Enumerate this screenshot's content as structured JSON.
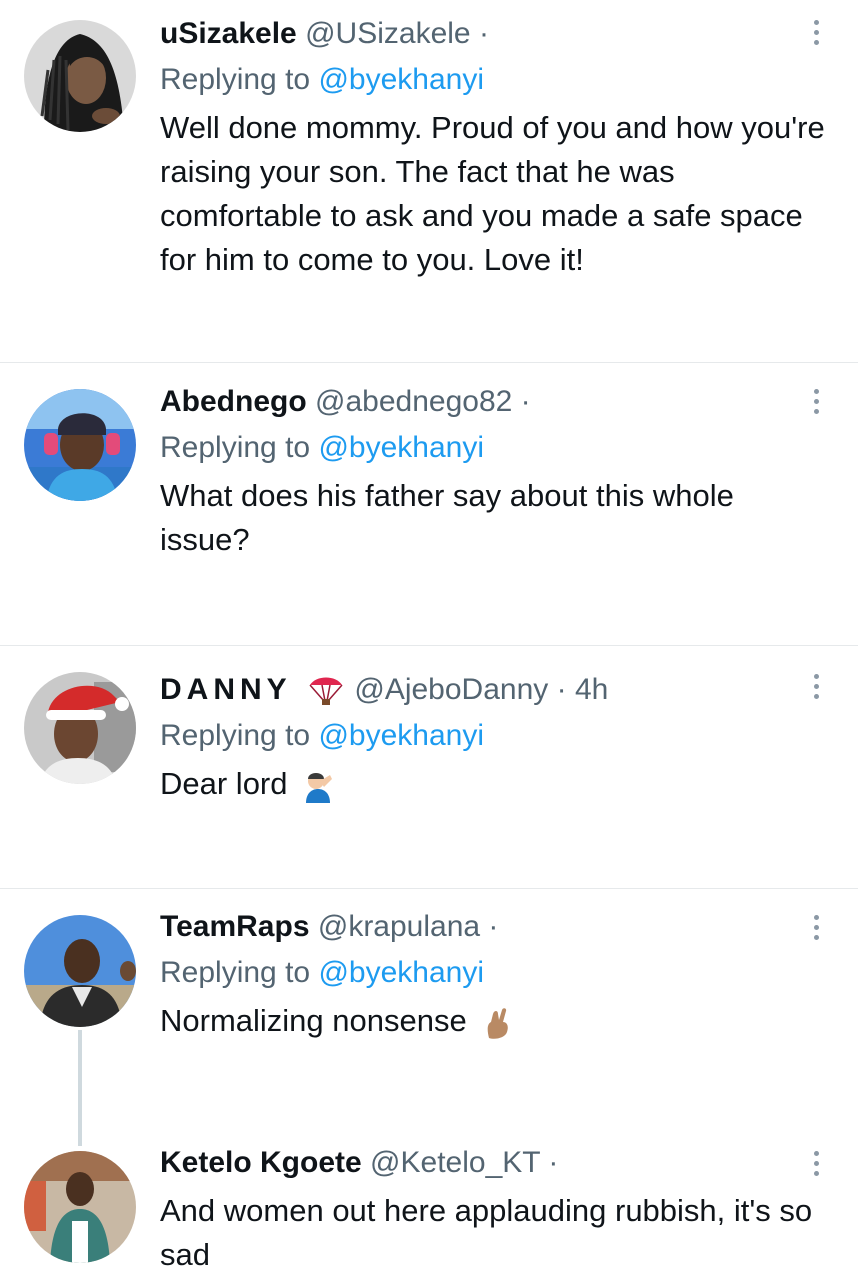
{
  "tweets": [
    {
      "name": "uSizakele",
      "handle": "@USizakele",
      "separator": "·",
      "time": "",
      "replying_prefix": "Replying to",
      "replying_to": "@byekhanyi",
      "text": "Well done mommy. Proud of you and how you're raising your son. The fact that he was comfortable to ask and you made a safe space for him to come to you. Love it!"
    },
    {
      "name": "Abednego",
      "handle": "@abednego82",
      "separator": "·",
      "time": "",
      "replying_prefix": "Replying to",
      "replying_to": "@byekhanyi",
      "text": "What does his father say about this whole issue?"
    },
    {
      "name": "DANNY",
      "name_emoji": "parachute-emoji",
      "handle": "@AjeboDanny",
      "separator": "·",
      "time": "4h",
      "replying_prefix": "Replying to",
      "replying_to": "@byekhanyi",
      "text": "Dear lord",
      "text_emoji": "man-facepalming-emoji"
    },
    {
      "name": "TeamRaps",
      "handle": "@krapulana",
      "separator": "·",
      "time": "",
      "replying_prefix": "Replying to",
      "replying_to": "@byekhanyi",
      "text": "Normalizing nonsense",
      "text_emoji": "crossed-fingers-emoji"
    },
    {
      "name": "Ketelo Kgoete",
      "handle": "@Ketelo_KT",
      "separator": "·",
      "time": "",
      "text": "And women out here applauding rubbish, it's so sad"
    }
  ],
  "colors": {
    "text_primary": "#0f1419",
    "text_secondary": "#536471",
    "link": "#1d9bf0",
    "divider": "#e6e9eb",
    "thread_line": "#cfd9de"
  },
  "icons": {
    "more": "more-vertical-icon"
  }
}
